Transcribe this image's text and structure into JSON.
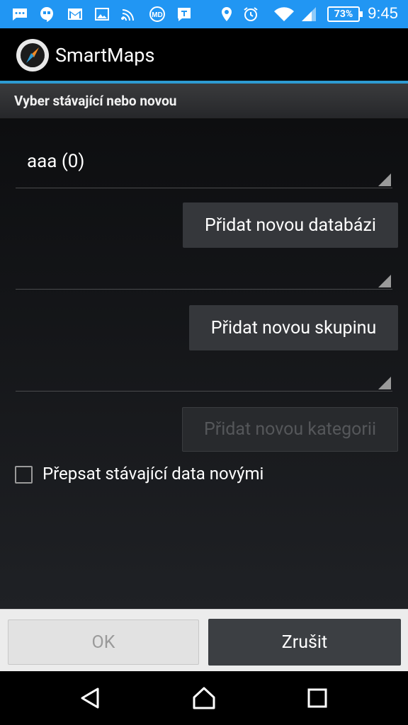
{
  "status_bar": {
    "time": "9:45",
    "battery": "73%",
    "icons": [
      "chat-icon",
      "hangouts-icon",
      "gmail-icon",
      "image-icon",
      "cast-icon",
      "md-icon",
      "t-app-icon",
      "location-icon",
      "alarm-icon",
      "wifi-icon",
      "signal-icon"
    ]
  },
  "action_bar": {
    "title": "SmartMaps"
  },
  "dialog": {
    "title": "Vyber stávající nebo novou",
    "database_spinner": {
      "value": "aaa (0)"
    },
    "add_database_label": "Přidat novou databázi",
    "group_spinner": {
      "value": ""
    },
    "add_group_label": "Přidat novou skupinu",
    "category_spinner": {
      "value": ""
    },
    "add_category_label": "Přidat novou kategorii",
    "overwrite_checkbox": {
      "label": "Přepsat stávající data novými",
      "checked": false
    },
    "ok_label": "OK",
    "cancel_label": "Zrušit"
  },
  "colors": {
    "status_bar": "#2196f3",
    "accent": "#2d9bd2"
  }
}
